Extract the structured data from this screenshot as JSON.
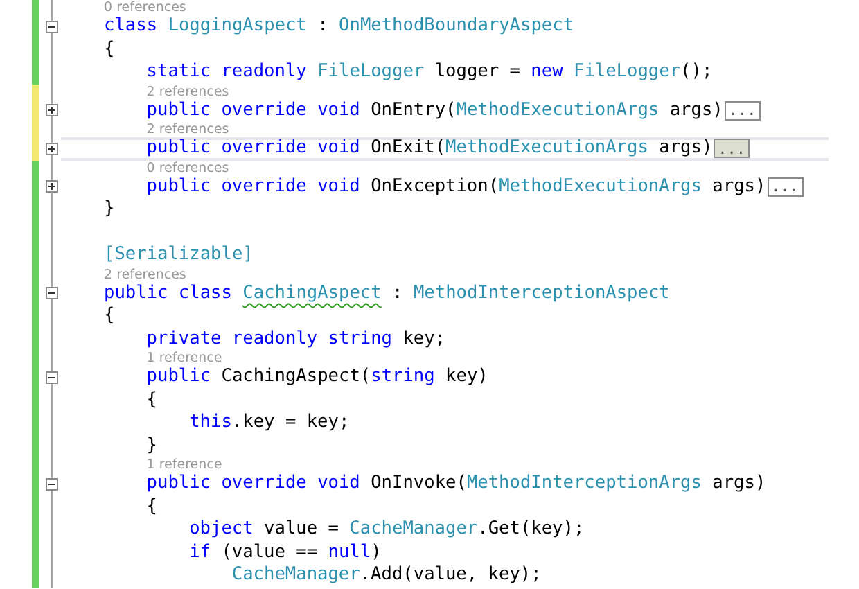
{
  "lines": [
    {
      "kind": "lens",
      "modified": false,
      "text": "0 references"
    },
    {
      "kind": "code",
      "modified": false,
      "expanded": true,
      "tokens": [
        {
          "text": "class ",
          "kind": "keyword"
        },
        {
          "text": "LoggingAspect",
          "kind": "type"
        },
        {
          "text": " : ",
          "kind": "plain"
        },
        {
          "text": "OnMethodBoundaryAspect",
          "kind": "type"
        }
      ]
    },
    {
      "kind": "code",
      "modified": false,
      "tokens": [
        {
          "text": "{",
          "kind": "plain"
        }
      ]
    },
    {
      "kind": "code",
      "modified": false,
      "tokens": [
        {
          "text": "    static readonly ",
          "kind": "keyword"
        },
        {
          "text": "FileLogger",
          "kind": "type"
        },
        {
          "text": " logger = ",
          "kind": "plain"
        },
        {
          "text": "new ",
          "kind": "keyword"
        },
        {
          "text": "FileLogger",
          "kind": "type"
        },
        {
          "text": "();",
          "kind": "plain"
        }
      ]
    },
    {
      "kind": "lens",
      "modified": true,
      "text": "2 references"
    },
    {
      "kind": "code",
      "modified": true,
      "expanded": false,
      "tokens": [
        {
          "text": "    public override void",
          "kind": "keyword"
        },
        {
          "text": " OnEntry(",
          "kind": "plain"
        },
        {
          "text": "MethodExecutionArgs",
          "kind": "type"
        },
        {
          "text": " args)",
          "kind": "plain"
        }
      ],
      "collapsed": {
        "text": "...",
        "selected": false
      }
    },
    {
      "kind": "lens",
      "modified": true,
      "text": "2 references"
    },
    {
      "kind": "code",
      "modified": true,
      "expanded": false,
      "current": true,
      "tokens": [
        {
          "text": "    public override void",
          "kind": "keyword"
        },
        {
          "text": " OnExit(",
          "kind": "plain"
        },
        {
          "text": "MethodExecutionArgs",
          "kind": "type"
        },
        {
          "text": " args)",
          "kind": "plain"
        }
      ],
      "collapsed": {
        "text": "...",
        "selected": true
      }
    },
    {
      "kind": "lens",
      "modified": false,
      "text": "0 references"
    },
    {
      "kind": "code",
      "modified": false,
      "expanded": false,
      "tokens": [
        {
          "text": "    public override void",
          "kind": "keyword"
        },
        {
          "text": " OnException(",
          "kind": "plain"
        },
        {
          "text": "MethodExecutionArgs",
          "kind": "type"
        },
        {
          "text": " args)",
          "kind": "plain"
        }
      ],
      "collapsed": {
        "text": "...",
        "selected": false
      }
    },
    {
      "kind": "code",
      "modified": false,
      "tokens": [
        {
          "text": "}",
          "kind": "plain"
        }
      ]
    },
    {
      "kind": "code",
      "modified": false
    },
    {
      "kind": "code",
      "modified": false,
      "tokens": [
        {
          "text": "[Serializable]",
          "kind": "type"
        }
      ]
    },
    {
      "kind": "lens",
      "modified": false,
      "text": "2 references"
    },
    {
      "kind": "code",
      "modified": false,
      "expanded": true,
      "tokens": [
        {
          "text": "public class ",
          "kind": "keyword"
        },
        {
          "text": "CachingAspect",
          "kind": "type",
          "squiggle": true
        },
        {
          "text": " : ",
          "kind": "plain"
        },
        {
          "text": "MethodInterceptionAspect",
          "kind": "type"
        }
      ]
    },
    {
      "kind": "code",
      "modified": false,
      "tokens": [
        {
          "text": "{",
          "kind": "plain"
        }
      ]
    },
    {
      "kind": "code",
      "modified": false,
      "tokens": [
        {
          "text": "    private readonly string",
          "kind": "keyword"
        },
        {
          "text": " key;",
          "kind": "plain"
        }
      ]
    },
    {
      "kind": "lens",
      "modified": false,
      "text": "1 reference"
    },
    {
      "kind": "code",
      "modified": false,
      "expanded": true,
      "tokens": [
        {
          "text": "    public",
          "kind": "keyword"
        },
        {
          "text": " CachingAspect(",
          "kind": "plain"
        },
        {
          "text": "string",
          "kind": "keyword"
        },
        {
          "text": " key)",
          "kind": "plain"
        }
      ]
    },
    {
      "kind": "code",
      "modified": false,
      "tokens": [
        {
          "text": "    {",
          "kind": "plain"
        }
      ]
    },
    {
      "kind": "code",
      "modified": false,
      "tokens": [
        {
          "text": "        this",
          "kind": "keyword"
        },
        {
          "text": ".key = key;",
          "kind": "plain"
        }
      ]
    },
    {
      "kind": "code",
      "modified": false,
      "tokens": [
        {
          "text": "    }",
          "kind": "plain"
        }
      ]
    },
    {
      "kind": "lens",
      "modified": false,
      "text": "1 reference"
    },
    {
      "kind": "code",
      "modified": false,
      "expanded": true,
      "tokens": [
        {
          "text": "    public override void",
          "kind": "keyword"
        },
        {
          "text": " OnInvoke(",
          "kind": "plain"
        },
        {
          "text": "MethodInterceptionArgs",
          "kind": "type"
        },
        {
          "text": " args)",
          "kind": "plain"
        }
      ]
    },
    {
      "kind": "code",
      "modified": false,
      "tokens": [
        {
          "text": "    {",
          "kind": "plain"
        }
      ]
    },
    {
      "kind": "code",
      "modified": false,
      "tokens": [
        {
          "text": "        object",
          "kind": "keyword"
        },
        {
          "text": " value = ",
          "kind": "plain"
        },
        {
          "text": "CacheManager",
          "kind": "type"
        },
        {
          "text": ".Get(key);",
          "kind": "plain"
        }
      ]
    },
    {
      "kind": "code",
      "modified": false,
      "tokens": [
        {
          "text": "        if",
          "kind": "keyword"
        },
        {
          "text": " (value == ",
          "kind": "plain"
        },
        {
          "text": "null",
          "kind": "keyword"
        },
        {
          "text": ")",
          "kind": "plain"
        }
      ]
    },
    {
      "kind": "code",
      "modified": false,
      "tokens": [
        {
          "text": "            CacheManager",
          "kind": "type"
        },
        {
          "text": ".Add(value, key);",
          "kind": "plain"
        }
      ]
    }
  ]
}
